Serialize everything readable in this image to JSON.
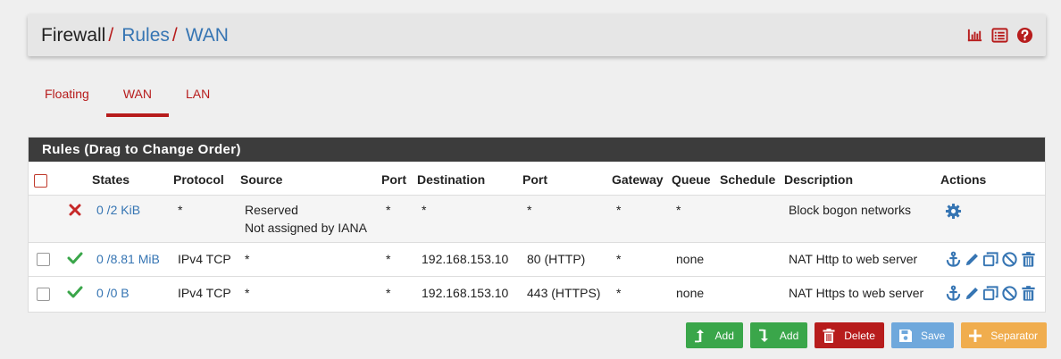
{
  "breadcrumb": {
    "root": "Firewall",
    "sep": "/",
    "items": [
      "Rules",
      "WAN"
    ]
  },
  "header_icons": [
    "bar-chart-icon",
    "list-icon",
    "help-icon"
  ],
  "tabs": [
    {
      "label": "Floating",
      "active": false
    },
    {
      "label": "WAN",
      "active": true
    },
    {
      "label": "LAN",
      "active": false
    }
  ],
  "panel": {
    "title": "Rules (Drag to Change Order)",
    "columns": [
      "States",
      "Protocol",
      "Source",
      "Port",
      "Destination",
      "Port",
      "Gateway",
      "Queue",
      "Schedule",
      "Description",
      "Actions"
    ],
    "rows": [
      {
        "status": "block",
        "states": "0 /2 KiB",
        "protocol": "*",
        "source": "Reserved",
        "source_line2": "Not assigned by IANA",
        "src_port": "*",
        "destination": "*",
        "dst_port": "*",
        "gateway": "*",
        "queue": "*",
        "schedule": "",
        "description": "Block bogon networks"
      },
      {
        "status": "pass",
        "states": "0 /8.81 MiB",
        "protocol": "IPv4 TCP",
        "source": "*",
        "src_port": "*",
        "destination": "192.168.153.10",
        "dst_port": "80 (HTTP)",
        "gateway": "*",
        "queue": "none",
        "schedule": "",
        "description": "NAT Http to web server"
      },
      {
        "status": "pass",
        "states": "0 /0 B",
        "protocol": "IPv4 TCP",
        "source": "*",
        "src_port": "*",
        "destination": "192.168.153.10",
        "dst_port": "443 (HTTPS)",
        "gateway": "*",
        "queue": "none",
        "schedule": "",
        "description": "NAT Https to web server"
      }
    ]
  },
  "buttons": {
    "add_top": "Add",
    "add_bottom": "Add",
    "delete": "Delete",
    "save": "Save",
    "separator": "Separator"
  },
  "colors": {
    "accent_red": "#b71c1c",
    "link_blue": "#3675b3",
    "pass_green": "#3aa64a",
    "heading_dark": "#3c3c3c"
  }
}
